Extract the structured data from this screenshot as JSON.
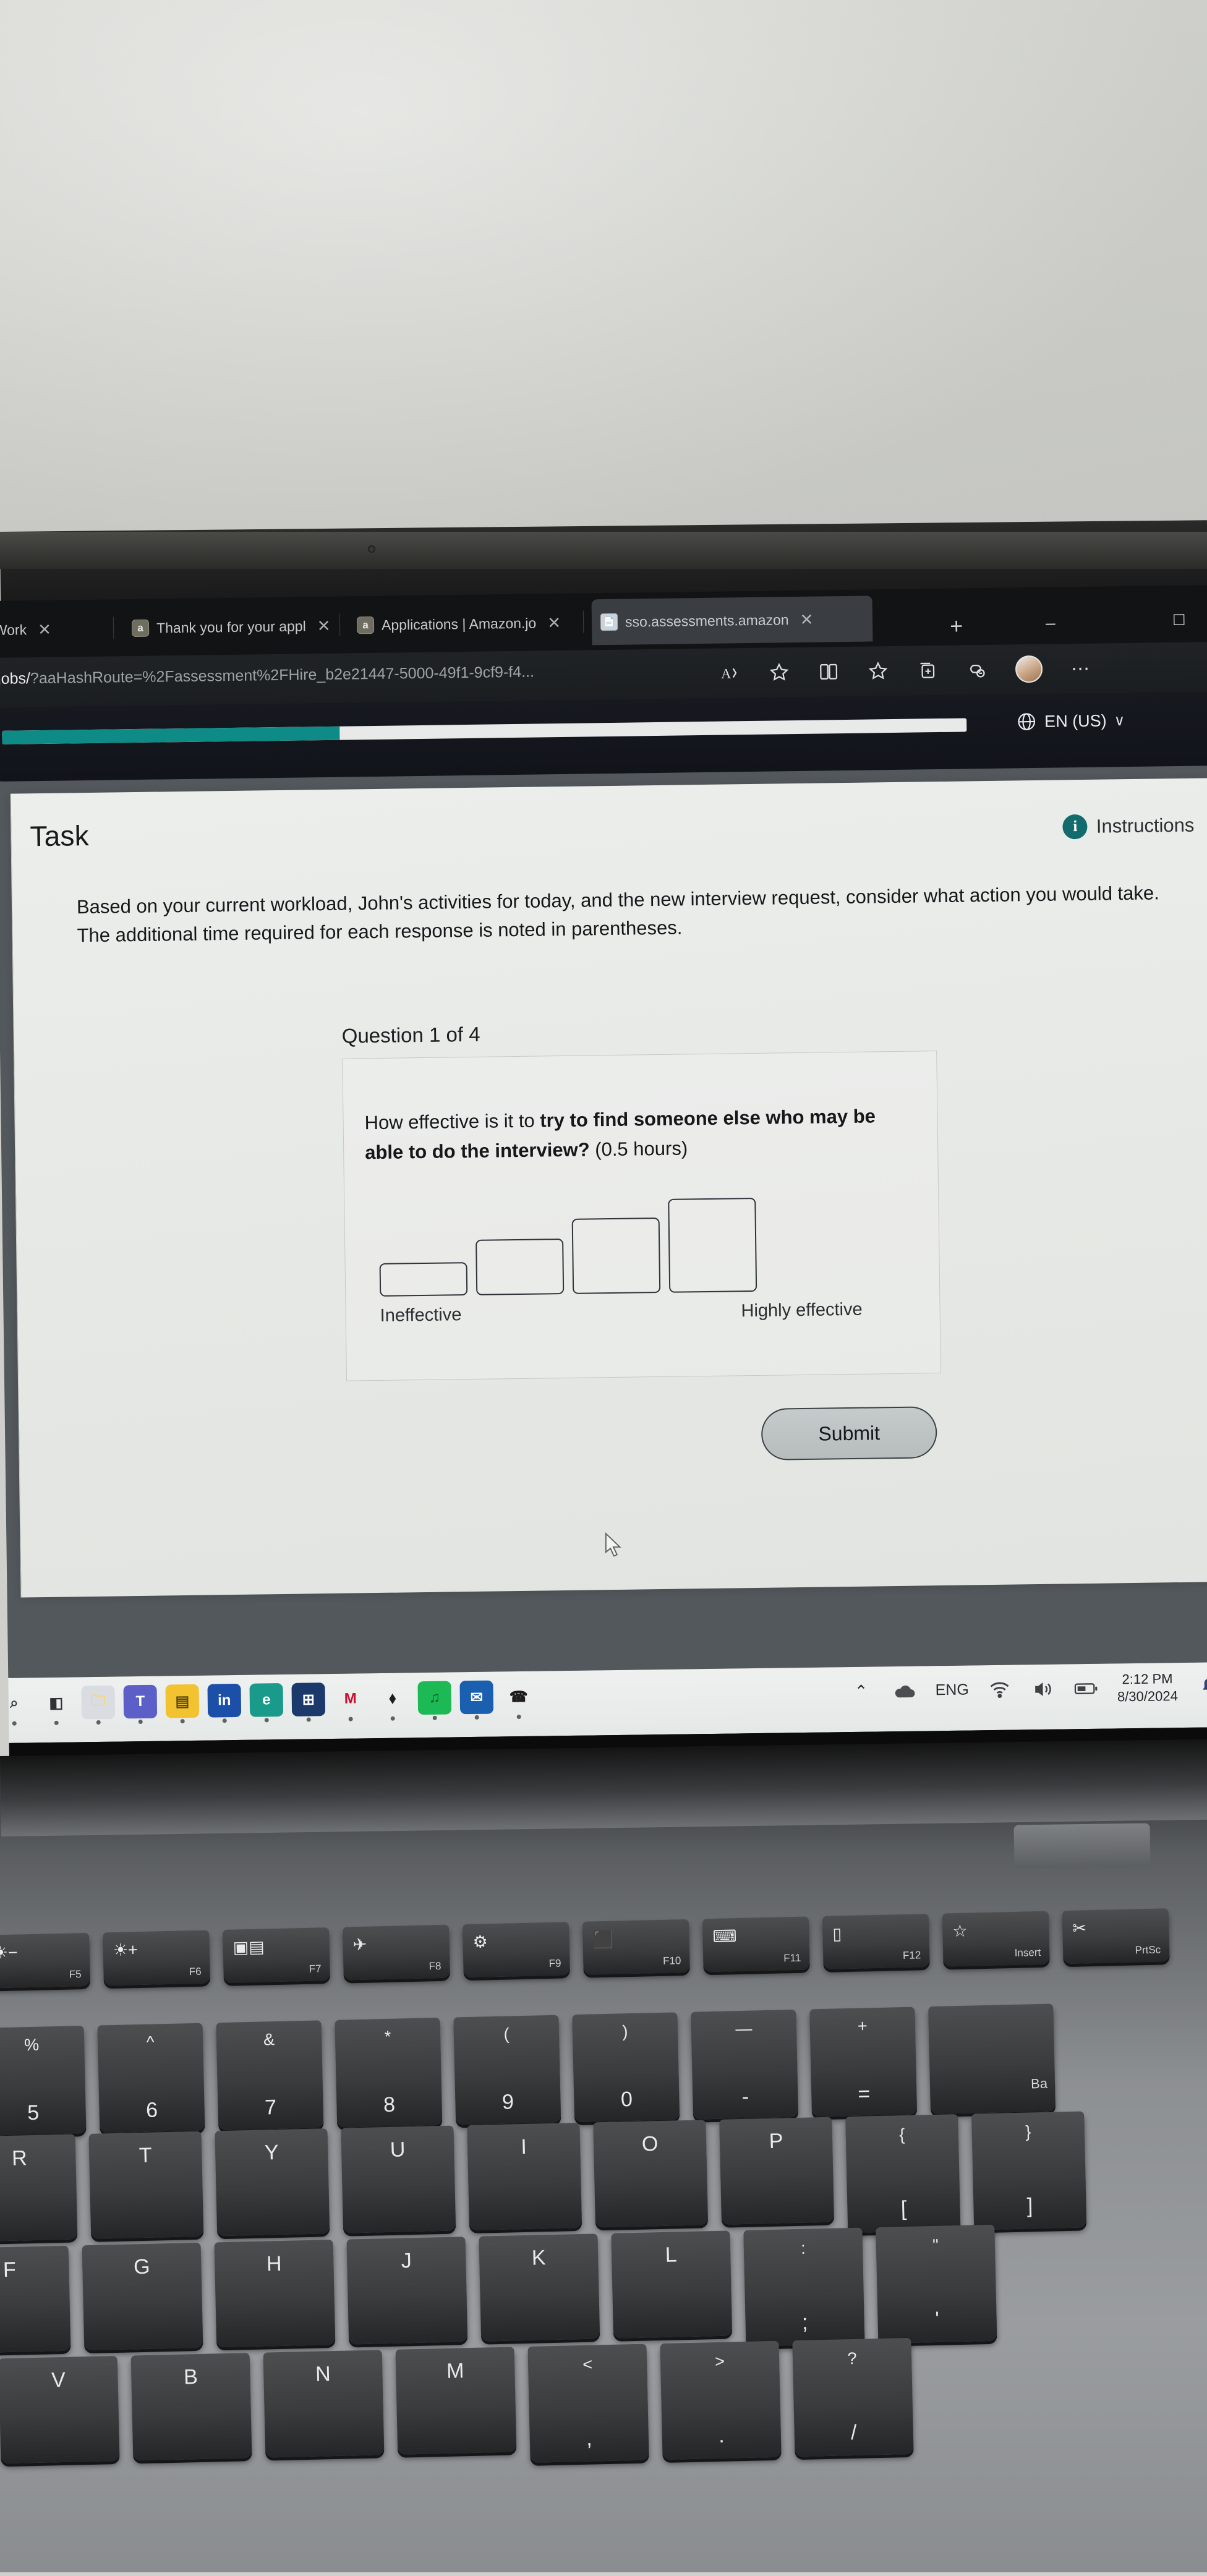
{
  "browser": {
    "tabs": [
      {
        "label": "ring Work",
        "favicon": "amazon-favicon",
        "active": false
      },
      {
        "label": "Thank you for your appl",
        "favicon": "amazon-favicon",
        "active": false
      },
      {
        "label": "Applications | Amazon.jo",
        "favicon": "amazon-favicon",
        "active": false
      },
      {
        "label": "sso.assessments.amazon",
        "favicon": "document-favicon",
        "active": true
      }
    ],
    "close_glyph": "✕",
    "new_tab_glyph": "+",
    "window_controls": "–",
    "url_prefix": "jobs/",
    "url_rest": "?aaHashRoute=%2Fassessment%2FHire_b2e21447-5000-49f1-9cf9-f4...",
    "toolbar_icons": [
      "read-aloud-icon",
      "favorite-star-icon",
      "split-screen-icon",
      "collections-icon",
      "browser-essentials-icon",
      "settings-icon",
      "profile-avatar",
      "more-options-icon"
    ]
  },
  "app_header": {
    "progress_percent": 35,
    "progress_color": "#0e8b87",
    "language": "EN (US)",
    "language_chevron": "∨",
    "globe_icon": "globe-icon"
  },
  "page": {
    "title": "Task",
    "instructions_label": "Instructions",
    "instructions_icon": "info-icon",
    "intro": "Based on your current workload, John's activities for today, and the new interview request, consider what action you would take. The additional time required for each response is noted in parentheses.",
    "question_counter": "Question 1 of 4",
    "question_lead": "How effective is it to ",
    "question_bold": "try to find someone else who may be able to do the interview?",
    "question_paren": " (0.5 hours)",
    "scale": {
      "label_low": "Ineffective",
      "label_high": "Highly effective",
      "options": [
        {
          "value": 1,
          "width": 138,
          "height": 50
        },
        {
          "value": 2,
          "width": 138,
          "height": 86
        },
        {
          "value": 3,
          "width": 138,
          "height": 118
        },
        {
          "value": 4,
          "width": 138,
          "height": 148
        }
      ],
      "selected": null
    },
    "submit_label": "Submit"
  },
  "taskbar": {
    "apps": [
      {
        "name": "search-icon",
        "glyph": "⌕",
        "color": "#3a3f44",
        "bg": "transparent"
      },
      {
        "name": "task-view-icon",
        "glyph": "◧",
        "color": "#2e3236",
        "bg": "transparent"
      },
      {
        "name": "file-explorer-icon",
        "glyph": "🗀",
        "color": "#f5d675",
        "bg": "#d9dce0"
      },
      {
        "name": "teams-icon",
        "glyph": "T",
        "color": "#ffffff",
        "bg": "#5b5fc7"
      },
      {
        "name": "notepad-icon",
        "glyph": "▤",
        "color": "#5a4a10",
        "bg": "#f2c230"
      },
      {
        "name": "linkedin-icon",
        "glyph": "in",
        "color": "#ffffff",
        "bg": "#1b4fa8"
      },
      {
        "name": "edge-icon",
        "glyph": "e",
        "color": "#ffffff",
        "bg": "#1a9a8a"
      },
      {
        "name": "microsoft-store-icon",
        "glyph": "⊞",
        "color": "#ffffff",
        "bg": "#1b3a6b"
      },
      {
        "name": "mcafee-icon",
        "glyph": "M",
        "color": "#c8102e",
        "bg": "transparent"
      },
      {
        "name": "dropbox-icon",
        "glyph": "⬧",
        "color": "#1c1c1c",
        "bg": "transparent"
      },
      {
        "name": "spotify-icon",
        "glyph": "♫",
        "color": "#0d5c2b",
        "bg": "#1db954"
      },
      {
        "name": "outlook-icon",
        "glyph": "✉",
        "color": "#ffffff",
        "bg": "#1b5fb0"
      },
      {
        "name": "whatsapp-icon",
        "glyph": "☎",
        "color": "#1d1d1d",
        "bg": "transparent"
      }
    ],
    "tray": {
      "overflow_glyph": "⌃",
      "cloud_icon": "onedrive-icon",
      "language": "ENG",
      "wifi_icon": "wifi-icon",
      "volume_icon": "volume-icon",
      "battery_icon": "battery-icon",
      "time": "2:12 PM",
      "date": "8/30/2024",
      "notification_icon": "bell-icon"
    }
  },
  "keyboard": {
    "function_row": [
      {
        "fn": "F5",
        "icon": "brightness-down-icon",
        "glyph": "☀−"
      },
      {
        "fn": "F6",
        "icon": "brightness-up-icon",
        "glyph": "☀+"
      },
      {
        "fn": "F7",
        "icon": "project-display-icon",
        "glyph": "▣▤"
      },
      {
        "fn": "F8",
        "icon": "airplane-mode-icon",
        "glyph": "✈"
      },
      {
        "fn": "F9",
        "icon": "settings-gear-icon",
        "glyph": "⚙"
      },
      {
        "fn": "F10",
        "icon": "lock-icon",
        "glyph": "⬛"
      },
      {
        "fn": "F11",
        "icon": "keyboard-backlight-icon",
        "glyph": "⌨"
      },
      {
        "fn": "F12",
        "icon": "calculator-icon",
        "glyph": "▯"
      },
      {
        "fn": "Insert",
        "icon": "star-icon",
        "glyph": "☆"
      },
      {
        "fn": "PrtSc",
        "icon": "snip-icon",
        "glyph": "✂"
      }
    ],
    "number_row": [
      {
        "top": "%",
        "main": "5"
      },
      {
        "top": "^",
        "main": "6"
      },
      {
        "top": "&",
        "main": "7"
      },
      {
        "top": "*",
        "main": "8"
      },
      {
        "top": "(",
        "main": "9"
      },
      {
        "top": ")",
        "main": "0"
      },
      {
        "top": "—",
        "main": "-"
      },
      {
        "top": "+",
        "main": "="
      },
      {
        "top": "",
        "main": "",
        "label": "Ba"
      }
    ],
    "qwerty_row": [
      {
        "main": "R"
      },
      {
        "main": "T"
      },
      {
        "main": "Y"
      },
      {
        "main": "U"
      },
      {
        "main": "I"
      },
      {
        "main": "O"
      },
      {
        "main": "P"
      },
      {
        "top": "{",
        "main": "["
      },
      {
        "top": "}",
        "main": "]"
      }
    ],
    "home_row": [
      {
        "main": "F"
      },
      {
        "main": "G"
      },
      {
        "main": "H"
      },
      {
        "main": "J"
      },
      {
        "main": "K"
      },
      {
        "main": "L"
      },
      {
        "top": ":",
        "main": ";"
      },
      {
        "top": "\"",
        "main": "'"
      }
    ],
    "bottom_row": [
      {
        "main": "V"
      },
      {
        "main": "B"
      },
      {
        "main": "N"
      },
      {
        "main": "M"
      },
      {
        "top": "<",
        "main": ","
      },
      {
        "top": ">",
        "main": "."
      },
      {
        "top": "?",
        "main": "/"
      }
    ]
  }
}
